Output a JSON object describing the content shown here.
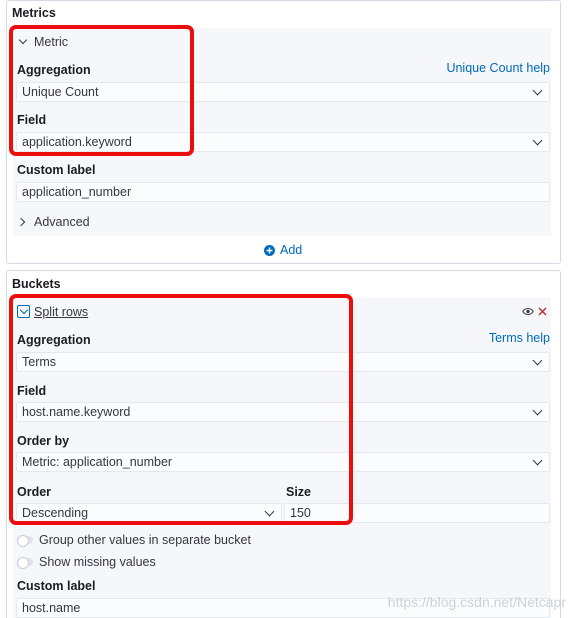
{
  "metrics": {
    "section_title": "Metrics",
    "metric_toggle_label": "Metric",
    "aggregation_label": "Aggregation",
    "aggregation_help": "Unique Count help",
    "aggregation_value": "Unique Count",
    "field_label": "Field",
    "field_value": "application.keyword",
    "custom_label_label": "Custom label",
    "custom_label_value": "application_number",
    "advanced_label": "Advanced",
    "add_label": "Add"
  },
  "buckets": {
    "section_title": "Buckets",
    "split_label": "Split rows",
    "aggregation_label": "Aggregation",
    "aggregation_help": "Terms help",
    "aggregation_value": "Terms",
    "field_label": "Field",
    "field_value": "host.name.keyword",
    "order_by_label": "Order by",
    "order_by_value": "Metric: application_number",
    "order_label": "Order",
    "order_value": "Descending",
    "size_label": "Size",
    "size_value": "150",
    "group_other_label": "Group other values in separate bucket",
    "show_missing_label": "Show missing values",
    "custom_label_label": "Custom label",
    "custom_label_value": "host.name"
  },
  "watermark": "https://blog.csdn.net/Netcapr",
  "icons": {
    "eye": "eye-icon",
    "close": "close-icon",
    "add": "plus-circle-icon",
    "collapse": "chevron-down-icon"
  },
  "colors": {
    "link": "#006bb8",
    "annotation": "#ec0d0d",
    "remove": "#bd271e"
  }
}
